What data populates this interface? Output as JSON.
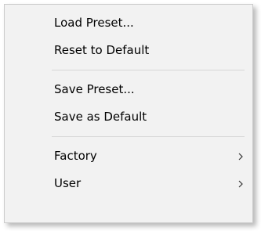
{
  "menu": {
    "groups": [
      {
        "items": [
          {
            "label": "Load Preset..."
          },
          {
            "label": "Reset to Default"
          }
        ]
      },
      {
        "items": [
          {
            "label": "Save Preset..."
          },
          {
            "label": "Save as Default"
          }
        ]
      },
      {
        "items": [
          {
            "label": "Factory",
            "submenu_icon": "chevron-right-icon"
          },
          {
            "label": "User",
            "submenu_icon": "chevron-right-icon"
          }
        ]
      }
    ]
  },
  "colors": {
    "menu_background": "#f2f2f2",
    "menu_border": "#cccccc",
    "separator": "#d7d7d7",
    "text": "#000000"
  }
}
